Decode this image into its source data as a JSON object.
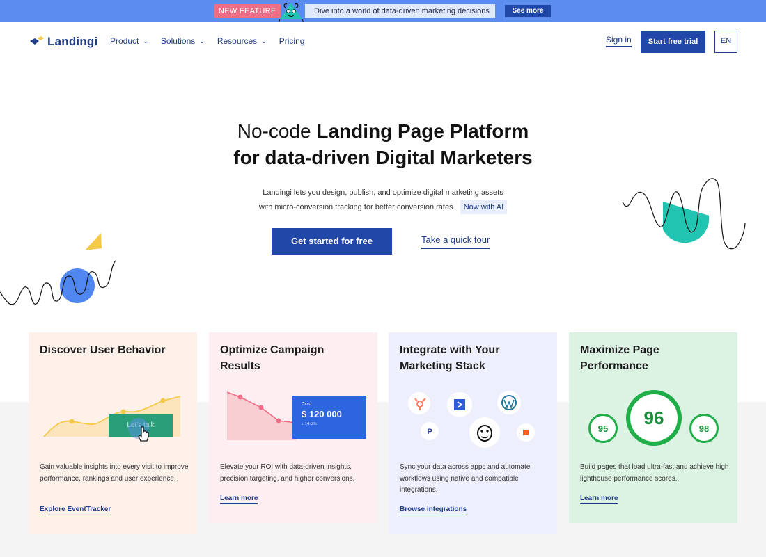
{
  "announcement": {
    "badge": "NEW FEATURE",
    "text": "Dive into a world of data-driven marketing decisions",
    "button": "See more"
  },
  "header": {
    "logo_text": "Landingi",
    "nav": [
      {
        "label": "Product",
        "has_dropdown": true
      },
      {
        "label": "Solutions",
        "has_dropdown": true
      },
      {
        "label": "Resources",
        "has_dropdown": true
      },
      {
        "label": "Pricing",
        "has_dropdown": false
      }
    ],
    "sign_in": "Sign in",
    "trial": "Start free trial",
    "lang": "EN"
  },
  "hero": {
    "title_light": "No-code ",
    "title_bold_1": "Landing Page Platform",
    "title_bold_2": "for data-driven Digital Marketers",
    "subtitle_line1": "Landingi lets you design, publish, and optimize digital marketing assets",
    "subtitle_line2": "with micro-conversion tracking for better conversion rates.",
    "ai_badge": "Now with AI",
    "cta_primary": "Get started for free",
    "cta_secondary": "Take a quick tour"
  },
  "cards": [
    {
      "title": "Discover User Behavior",
      "illustration_button": "Let's talk",
      "desc": "Gain valuable insights into every visit to improve performance, rankings and user experience.",
      "link": "Explore EventTracker"
    },
    {
      "title": "Optimize Campaign Results",
      "cost_label": "Cost",
      "cost_value": "$ 120 000",
      "cost_delta": "↓ 14.6%",
      "desc": "Elevate your ROI with data-driven insights, precision targeting, and higher conversions.",
      "link": "Learn more"
    },
    {
      "title": "Integrate with Your Marketing Stack",
      "integrations": [
        "hubspot-icon",
        "activecampaign-icon",
        "wordpress-icon",
        "paypal-icon",
        "mailchimp-icon",
        "small-app-icon"
      ],
      "desc": "Sync your data across apps and automate workflows using native and compatible integrations.",
      "link": "Browse integrations"
    },
    {
      "title": "Maximize Page Performance",
      "scores": [
        "95",
        "96",
        "98"
      ],
      "desc": "Build pages that load ultra-fast and achieve high lighthouse performance scores.",
      "link": "Learn more"
    }
  ],
  "colors": {
    "brand_blue": "#2148a8",
    "topbar": "#5b8def",
    "badge_pink": "#ef6e87",
    "teal": "#20c4b0",
    "yellow": "#f5c94a",
    "green_score": "#1fae48"
  }
}
